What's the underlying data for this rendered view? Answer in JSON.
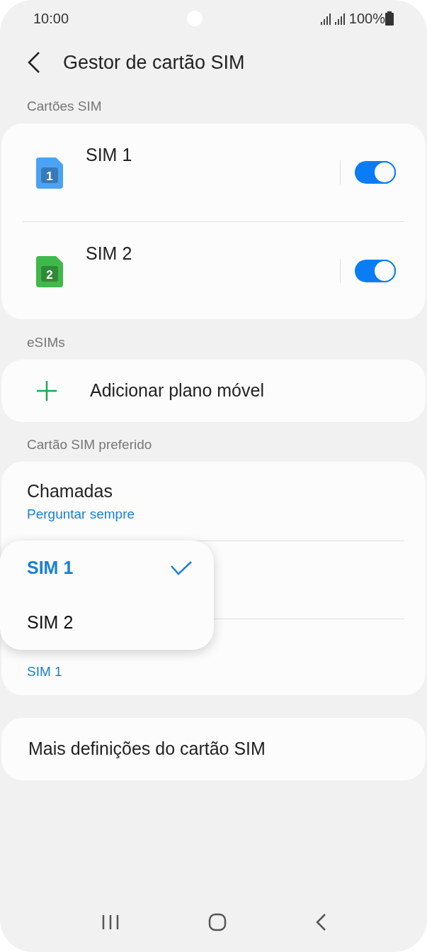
{
  "status_bar": {
    "time": "10:00",
    "battery": "100%"
  },
  "header": {
    "title": "Gestor de cartão SIM"
  },
  "sim_cards": {
    "heading": "Cartões SIM",
    "items": [
      {
        "label": "SIM 1",
        "number": "1",
        "color": "#4aa3f5",
        "on": true
      },
      {
        "label": "SIM 2",
        "number": "2",
        "color": "#3fb94a",
        "on": true
      }
    ]
  },
  "esims": {
    "heading": "eSIMs",
    "action": "Adicionar plano móvel"
  },
  "preferred": {
    "heading": "Cartão SIM preferido",
    "rows": [
      {
        "title": "Chamadas",
        "value": "Perguntar sempre"
      },
      {
        "value": "SIM 1"
      }
    ]
  },
  "popup": {
    "options": [
      {
        "label": "SIM 1",
        "selected": true
      },
      {
        "label": "SIM 2",
        "selected": false
      }
    ]
  },
  "more": {
    "label": "Mais definições do cartão SIM"
  }
}
